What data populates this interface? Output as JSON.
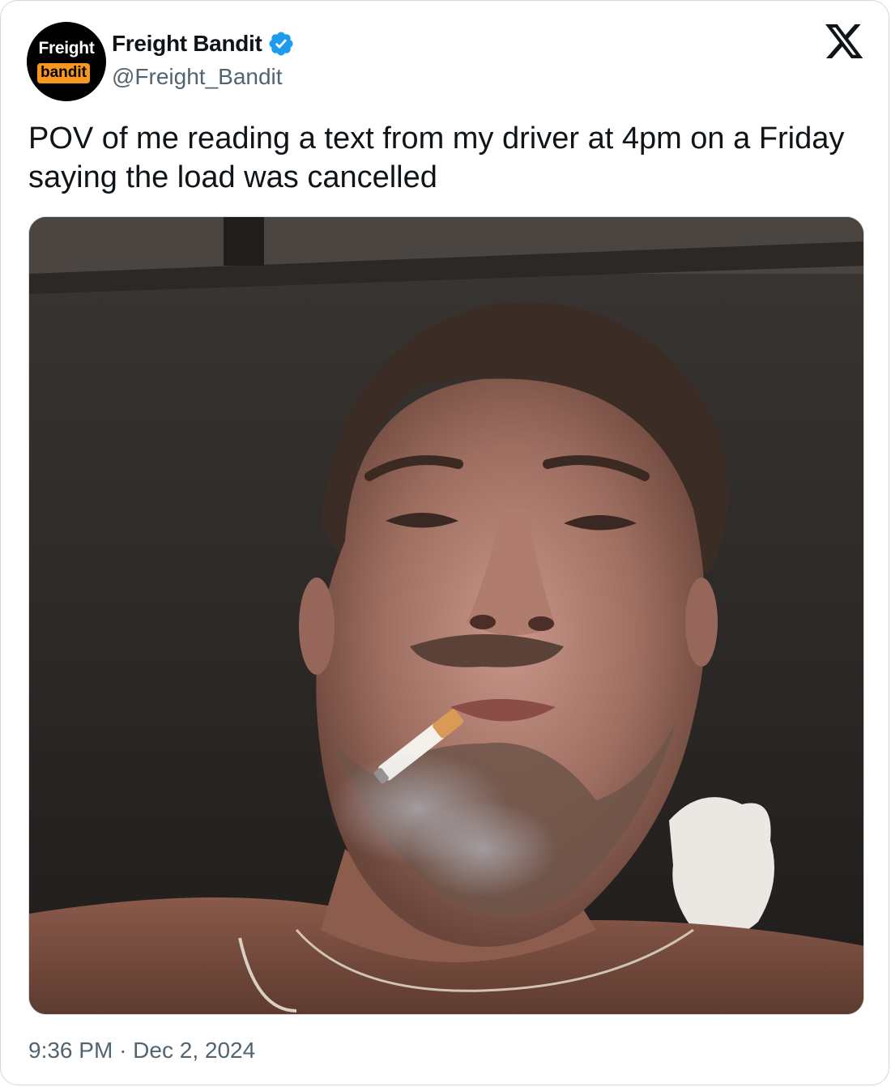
{
  "author": {
    "avatar_text_top": "Freight",
    "avatar_text_bottom": "bandit",
    "display_name": "Freight Bandit",
    "handle": "@Freight_Bandit",
    "verified": true
  },
  "tweet": {
    "text": "POV of me reading a text from my driver at 4pm on a Friday saying the load was cancelled",
    "time": "9:36 PM",
    "separator": "·",
    "date": "Dec 2, 2024"
  },
  "colors": {
    "text_primary": "#0f1419",
    "text_secondary": "#536471",
    "verified_blue": "#1d9bf0",
    "border": "#cfd9de",
    "avatar_accent": "#f7971d"
  },
  "icons": {
    "platform_logo": "x-logo-icon",
    "verified": "verified-badge-icon"
  }
}
